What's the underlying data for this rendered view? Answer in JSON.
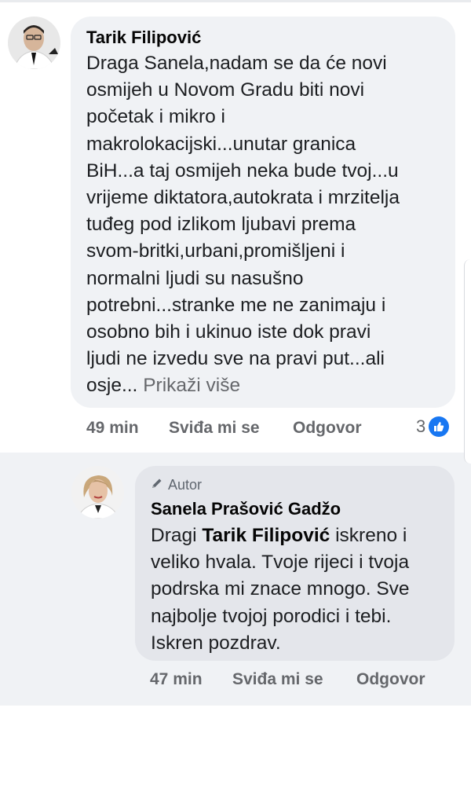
{
  "comment": {
    "author": "Tarik Filipović",
    "lines": [
      "Draga Sanela,nadam se da će novi",
      "osmijeh u Novom Gradu biti novi",
      "početak i mikro i",
      "makrolokacijski...unutar granica",
      "BiH...a taj osmijeh neka bude tvoj...u",
      "vrijeme diktatora,autokrata i mrzitelja",
      "tuđeg pod izlikom ljubavi prema",
      "svom-britki,urbani,promišljeni i",
      "normalni ljudi su nasušno",
      "potrebni...stranke me ne zanimaju i",
      "osobno bih i ukinuo iste dok pravi",
      "ljudi ne izvedu sve na pravi put...ali"
    ],
    "last_line_start": "osje...",
    "see_more": "Prikaži više",
    "time": "49 min",
    "like_label": "Sviđa mi se",
    "reply_label": "Odgovor",
    "reaction_count": "3",
    "reaction_icon": "thumbs-up-icon",
    "reaction_color": "#1877f2"
  },
  "reply": {
    "badge_icon": "pencil-icon",
    "badge": "Autor",
    "author": "Sanela Prašović Gadžo",
    "greeting": "Dragi",
    "mention": "Tarik Filipović",
    "first_rest": "iskreno i",
    "lines": [
      "veliko hvala. Tvoje rijeci i tvoja",
      "podrska mi znace mnogo. Sve",
      "najbolje tvojoj porodici i tebi.",
      "Iskren pozdrav."
    ],
    "time": "47 min",
    "like_label": "Sviđa mi se",
    "reply_label": "Odgovor"
  }
}
